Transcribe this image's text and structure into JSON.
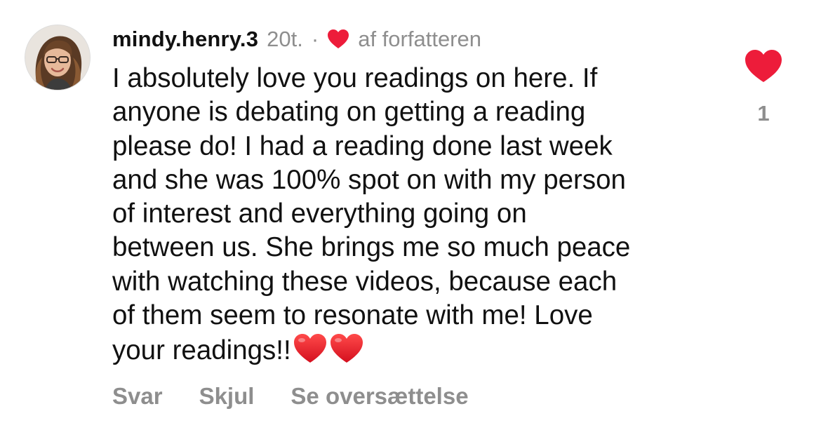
{
  "comment": {
    "username": "mindy.henry.3",
    "time": "20t.",
    "separator": "·",
    "author_like_icon": "heart-icon",
    "author_like_color": "#ED1C3A",
    "author_like_label": "af forfatteren",
    "text_lines": [
      "I absolutely love you readings on here. If",
      "anyone is debating on getting a reading",
      "please do! I had a reading done last week",
      "and she was 100% spot on with my person",
      "of interest and everything going on",
      "between us. She brings me so much peace",
      "with watching these videos, because each",
      "of them seem to resonate with me! Love",
      "your readings!!"
    ],
    "trailing_emoji": [
      "red-heart-emoji",
      "red-heart-emoji"
    ],
    "like": {
      "icon": "heart-filled-icon",
      "color": "#ED1C3A",
      "count": "1"
    },
    "actions": {
      "reply": "Svar",
      "hide": "Skjul",
      "translate": "Se oversættelse"
    }
  },
  "colors": {
    "primary_text": "#111111",
    "secondary_text": "#8E8E8E",
    "heart_red": "#ED1C3A"
  }
}
